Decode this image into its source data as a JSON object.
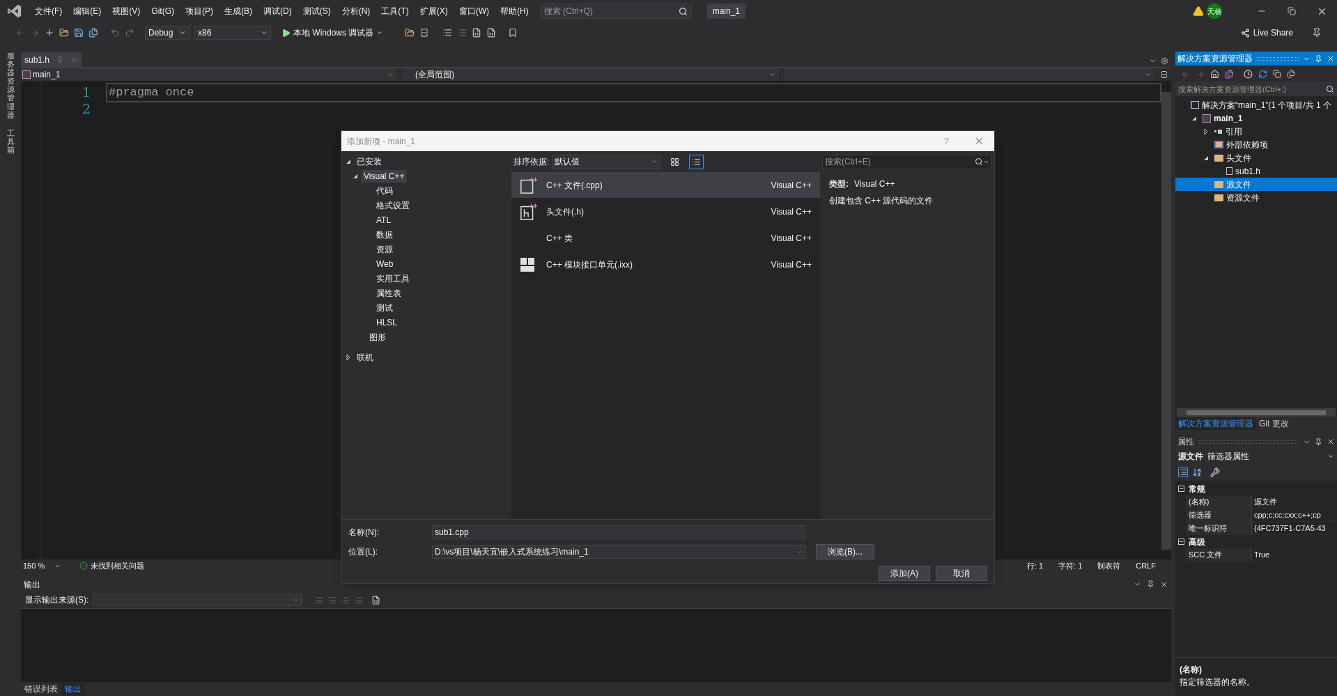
{
  "menu_bar": {
    "items": [
      "文件(F)",
      "编辑(E)",
      "视图(V)",
      "Git(G)",
      "项目(P)",
      "生成(B)",
      "调试(D)",
      "测试(S)",
      "分析(N)",
      "工具(T)",
      "扩展(X)",
      "窗口(W)",
      "帮助(H)"
    ],
    "search": {
      "placeholder": "搜索 (Ctrl+Q)"
    },
    "solution_name": "main_1",
    "account_initials": "天杨"
  },
  "toolbar": {
    "configuration": "Debug",
    "platform": "x86",
    "run_label": "本地 Windows 调试器",
    "live_share": "Live Share"
  },
  "side_strip": [
    "服务器资源管理器",
    "工具箱"
  ],
  "editor": {
    "tabs": [
      {
        "label": "sub1.h",
        "selected": true
      }
    ],
    "navigation": [
      "main_1",
      "(全局范围)"
    ],
    "line_numbers": [
      "1",
      "2"
    ],
    "code": [
      "#pragma once"
    ],
    "status": {
      "zoom": "150 %",
      "issues": "未找到相关问题",
      "position": [
        "行: 1",
        "字符: 1",
        "制表符",
        "CRLF"
      ]
    }
  },
  "output": {
    "title": "输出",
    "source_label": "显示输出来源(S):"
  },
  "bottom_tabs": [
    {
      "label": "错误列表",
      "selected": false
    },
    {
      "label": "输出",
      "selected": true
    }
  ],
  "solution_explorer": {
    "title": "解决方案资源管理器",
    "search": {
      "placeholder": "搜索解决方案资源管理器(Ctrl+;)"
    },
    "tree": [
      {
        "label": "解决方案“main_1”(1 个项目/共 1 个",
        "kind": "solution",
        "selected": false,
        "children": [
          {
            "label": "main_1",
            "kind": "project",
            "selected": false,
            "expanded": true,
            "children": [
              {
                "label": "引用",
                "kind": "references",
                "selected": false,
                "expanded": false
              },
              {
                "label": "外部依赖项",
                "kind": "external",
                "selected": false
              },
              {
                "label": "头文件",
                "kind": "folder",
                "selected": false,
                "expanded": true,
                "children": [
                  {
                    "label": "sub1.h",
                    "kind": "file",
                    "selected": false
                  }
                ]
              },
              {
                "label": "源文件",
                "kind": "folder",
                "selected": true
              },
              {
                "label": "资源文件",
                "kind": "folder",
                "selected": false
              }
            ]
          }
        ]
      }
    ],
    "tabs": [
      {
        "label": "解决方案资源管理器",
        "selected": true
      },
      {
        "label": "Git 更改",
        "selected": false
      }
    ]
  },
  "properties": {
    "title": "属性",
    "object": "源文件",
    "object_type": "筛选器属性",
    "categories": [
      {
        "name": "常规",
        "expanded": true,
        "rows": [
          {
            "name": "(名称)",
            "value": "源文件"
          },
          {
            "name": "筛选器",
            "value": "cpp;c;cc;cxx;c++;cp"
          },
          {
            "name": "唯一标识符",
            "value": "{4FC737F1-C7A5-43"
          }
        ]
      },
      {
        "name": "高级",
        "expanded": true,
        "rows": [
          {
            "name": "SCC 文件",
            "value": "True"
          }
        ]
      }
    ],
    "description": {
      "title": "(名称)",
      "text": "指定筛选器的名称。"
    }
  },
  "dialog": {
    "title": "添加新项 - main_1",
    "help": "?",
    "tree": [
      {
        "label": "已安装",
        "expanded": true,
        "selected": false,
        "children": [
          {
            "label": "Visual C++",
            "expanded": true,
            "selected": true,
            "children": [
              {
                "label": "代码",
                "selected": false
              },
              {
                "label": "格式设置",
                "selected": false
              },
              {
                "label": "ATL",
                "selected": false
              },
              {
                "label": "数据",
                "selected": false
              },
              {
                "label": "资源",
                "selected": false
              },
              {
                "label": "Web",
                "selected": false
              },
              {
                "label": "实用工具",
                "selected": false
              },
              {
                "label": "属性表",
                "selected": false
              },
              {
                "label": "测试",
                "selected": false
              },
              {
                "label": "HLSL",
                "selected": false
              }
            ]
          },
          {
            "label": "图形",
            "selected": false
          }
        ]
      },
      {
        "label": "联机",
        "expanded": false,
        "selected": false
      }
    ],
    "sort_label": "排序依据:",
    "sort_value": "默认值",
    "views": [
      {
        "kind": "grid",
        "selected": false
      },
      {
        "kind": "list",
        "selected": true
      }
    ],
    "templates": [
      {
        "name": "C++ 文件(.cpp)",
        "language": "Visual C++",
        "kind": "cpp",
        "selected": true
      },
      {
        "name": "头文件(.h)",
        "language": "Visual C++",
        "kind": "header",
        "selected": false
      },
      {
        "name": "C++ 类",
        "language": "Visual C++",
        "kind": "class",
        "selected": false
      },
      {
        "name": "C++ 模块接口单元(.ixx)",
        "language": "Visual C++",
        "kind": "module",
        "selected": false
      }
    ],
    "search": {
      "placeholder": "搜索(Ctrl+E)"
    },
    "details": {
      "type_label": "类型:",
      "type_value": "Visual C++",
      "description": "创建包含 C++ 源代码的文件"
    },
    "fields": [
      {
        "label": "名称(N):",
        "value": "sub1.cpp",
        "kind": "text"
      },
      {
        "label": "位置(L):",
        "value": "D:\\vs项目\\杨天宜\\嵌入式系统练习\\main_1",
        "kind": "combo"
      }
    ],
    "browse": "浏览(B)...",
    "buttons": [
      "添加(A)",
      "取消"
    ]
  }
}
